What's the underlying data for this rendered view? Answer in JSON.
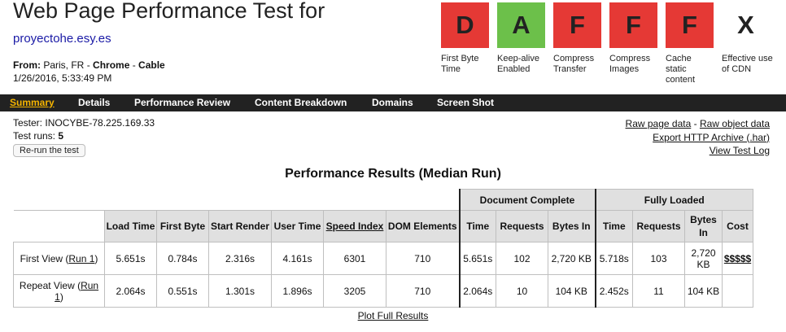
{
  "header": {
    "title": "Web Page Performance Test for",
    "site": "proyectohe.esy.es",
    "from_label": "From:",
    "from_location": "Paris, FR",
    "from_sep": " - ",
    "browser": "Chrome",
    "connection": "Cable",
    "date": "1/26/2016, 5:33:49 PM"
  },
  "grades": [
    {
      "letter": "D",
      "color": "#e53935",
      "label": "First Byte Time"
    },
    {
      "letter": "A",
      "color": "#6cc04a",
      "label": "Keep-alive Enabled"
    },
    {
      "letter": "F",
      "color": "#e53935",
      "label": "Compress Transfer"
    },
    {
      "letter": "F",
      "color": "#e53935",
      "label": "Compress Images"
    },
    {
      "letter": "F",
      "color": "#e53935",
      "label": "Cache static content"
    },
    {
      "letter": "X",
      "color": "none",
      "label": "Effective use of CDN"
    }
  ],
  "nav": [
    "Summary",
    "Details",
    "Performance Review",
    "Content Breakdown",
    "Domains",
    "Screen Shot"
  ],
  "info": {
    "tester_label": "Tester:",
    "tester": "INOCYBE-78.225.169.33",
    "runs_label": "Test runs:",
    "runs": "5",
    "rerun": "Re-run the test"
  },
  "links": {
    "raw_page": "Raw page data",
    "sep": " - ",
    "raw_object": "Raw object data",
    "har": "Export HTTP Archive (.har)",
    "log": "View Test Log"
  },
  "results": {
    "title": "Performance Results (Median Run)",
    "group_doc": "Document Complete",
    "group_full": "Fully Loaded",
    "columns": [
      "Load Time",
      "First Byte",
      "Start Render",
      "User Time",
      "Speed Index",
      "DOM Elements",
      "Time",
      "Requests",
      "Bytes In",
      "Time",
      "Requests",
      "Bytes In",
      "Cost"
    ],
    "rows": [
      {
        "label": "First View (",
        "run": "Run 1",
        "close": ")",
        "values": [
          "5.651s",
          "0.784s",
          "2.316s",
          "4.161s",
          "6301",
          "710",
          "5.651s",
          "102",
          "2,720 KB",
          "5.718s",
          "103",
          "2,720 KB"
        ],
        "cost": "$$$$$"
      },
      {
        "label": "Repeat View (",
        "run": "Run 1",
        "close": ")",
        "values": [
          "2.064s",
          "0.551s",
          "1.301s",
          "1.896s",
          "3205",
          "710",
          "2.064s",
          "10",
          "104 KB",
          "2.452s",
          "11",
          "104 KB"
        ],
        "cost": ""
      }
    ],
    "plot": "Plot Full Results"
  }
}
